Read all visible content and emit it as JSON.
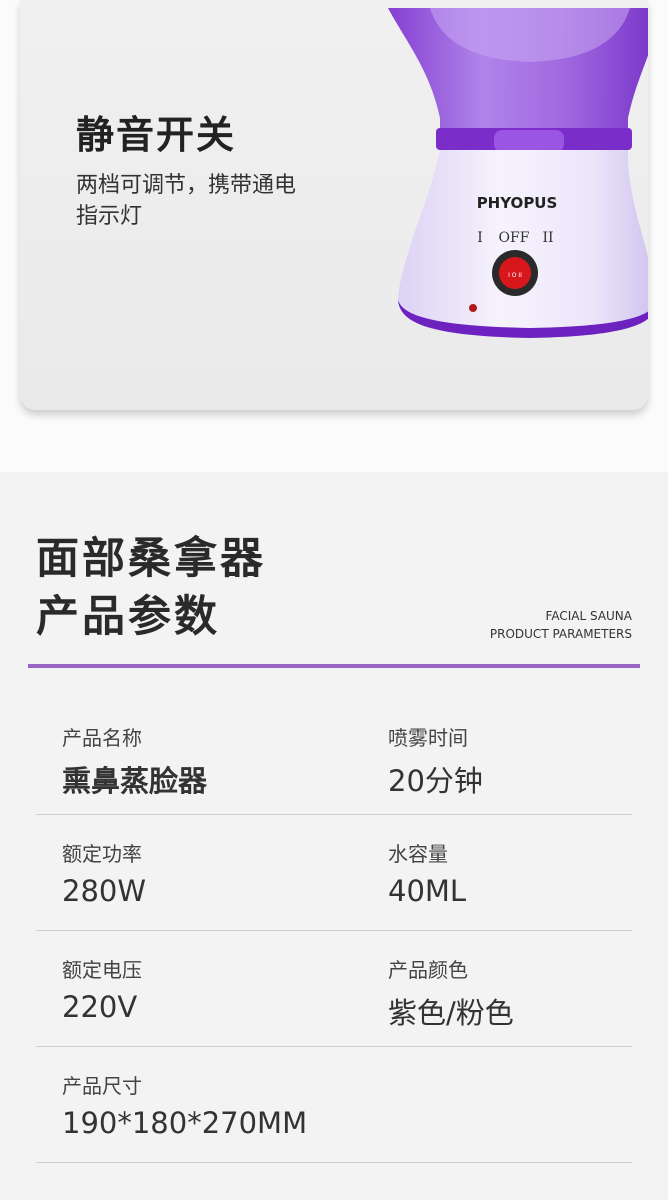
{
  "feature": {
    "title": "静音开关",
    "description": "两档可调节，携带通电指示灯",
    "device": {
      "brand": "PHYOPUS",
      "switch_left": "I",
      "switch_mid": "OFF",
      "switch_right": "II",
      "rocker_text": "I O II"
    }
  },
  "params": {
    "title_line1": "面部桑拿器",
    "title_line2": "产品参数",
    "en_line1": "FACIAL SAUNA",
    "en_line2": "PRODUCT PARAMETERS",
    "rows": [
      {
        "left": {
          "label": "产品名称",
          "value": "熏鼻蒸脸器"
        },
        "right": {
          "label": "喷雾时间",
          "value": "20分钟"
        }
      },
      {
        "left": {
          "label": "额定功率",
          "value": "280W"
        },
        "right": {
          "label": "水容量",
          "value": "40ML"
        }
      },
      {
        "left": {
          "label": "额定电压",
          "value": "220V"
        },
        "right": {
          "label": "产品颜色",
          "value": "紫色/粉色"
        }
      },
      {
        "left": {
          "label": "产品尺寸",
          "value": "190*180*270MM"
        }
      }
    ]
  },
  "colors": {
    "accent_purple": "#9a63c6",
    "device_purple": "#8b3fd6"
  }
}
